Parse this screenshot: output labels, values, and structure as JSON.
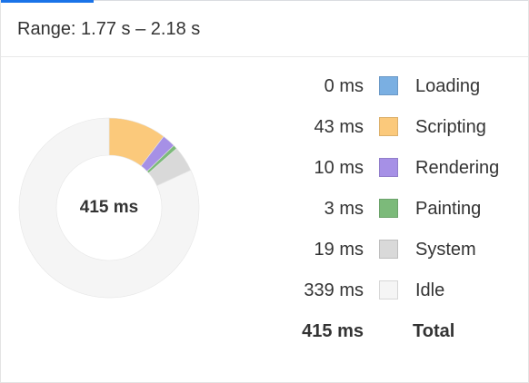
{
  "summary": {
    "range_text": "Range: 1.77 s – 2.18 s",
    "center_total": "415 ms"
  },
  "colors": {
    "loading": "#7aafe2",
    "scripting": "#fbc97b",
    "rendering": "#a690e6",
    "painting": "#7cba7a",
    "system": "#d9d9d9",
    "idle": "#f5f5f5",
    "accent": "#1a73e8"
  },
  "chart_data": {
    "type": "pie",
    "categories": [
      "Loading",
      "Scripting",
      "Rendering",
      "Painting",
      "System",
      "Idle"
    ],
    "values": [
      0,
      43,
      10,
      3,
      19,
      339
    ],
    "total": 415,
    "unit": "ms",
    "donut": true
  },
  "legend": {
    "rows": [
      {
        "value": "0 ms",
        "label": "Loading",
        "color": "#7aafe2"
      },
      {
        "value": "43 ms",
        "label": "Scripting",
        "color": "#fbc97b"
      },
      {
        "value": "10 ms",
        "label": "Rendering",
        "color": "#a690e6"
      },
      {
        "value": "3 ms",
        "label": "Painting",
        "color": "#7cba7a"
      },
      {
        "value": "19 ms",
        "label": "System",
        "color": "#d9d9d9"
      },
      {
        "value": "339 ms",
        "label": "Idle",
        "color": "#f5f5f5"
      }
    ],
    "total": {
      "value": "415 ms",
      "label": "Total"
    }
  }
}
